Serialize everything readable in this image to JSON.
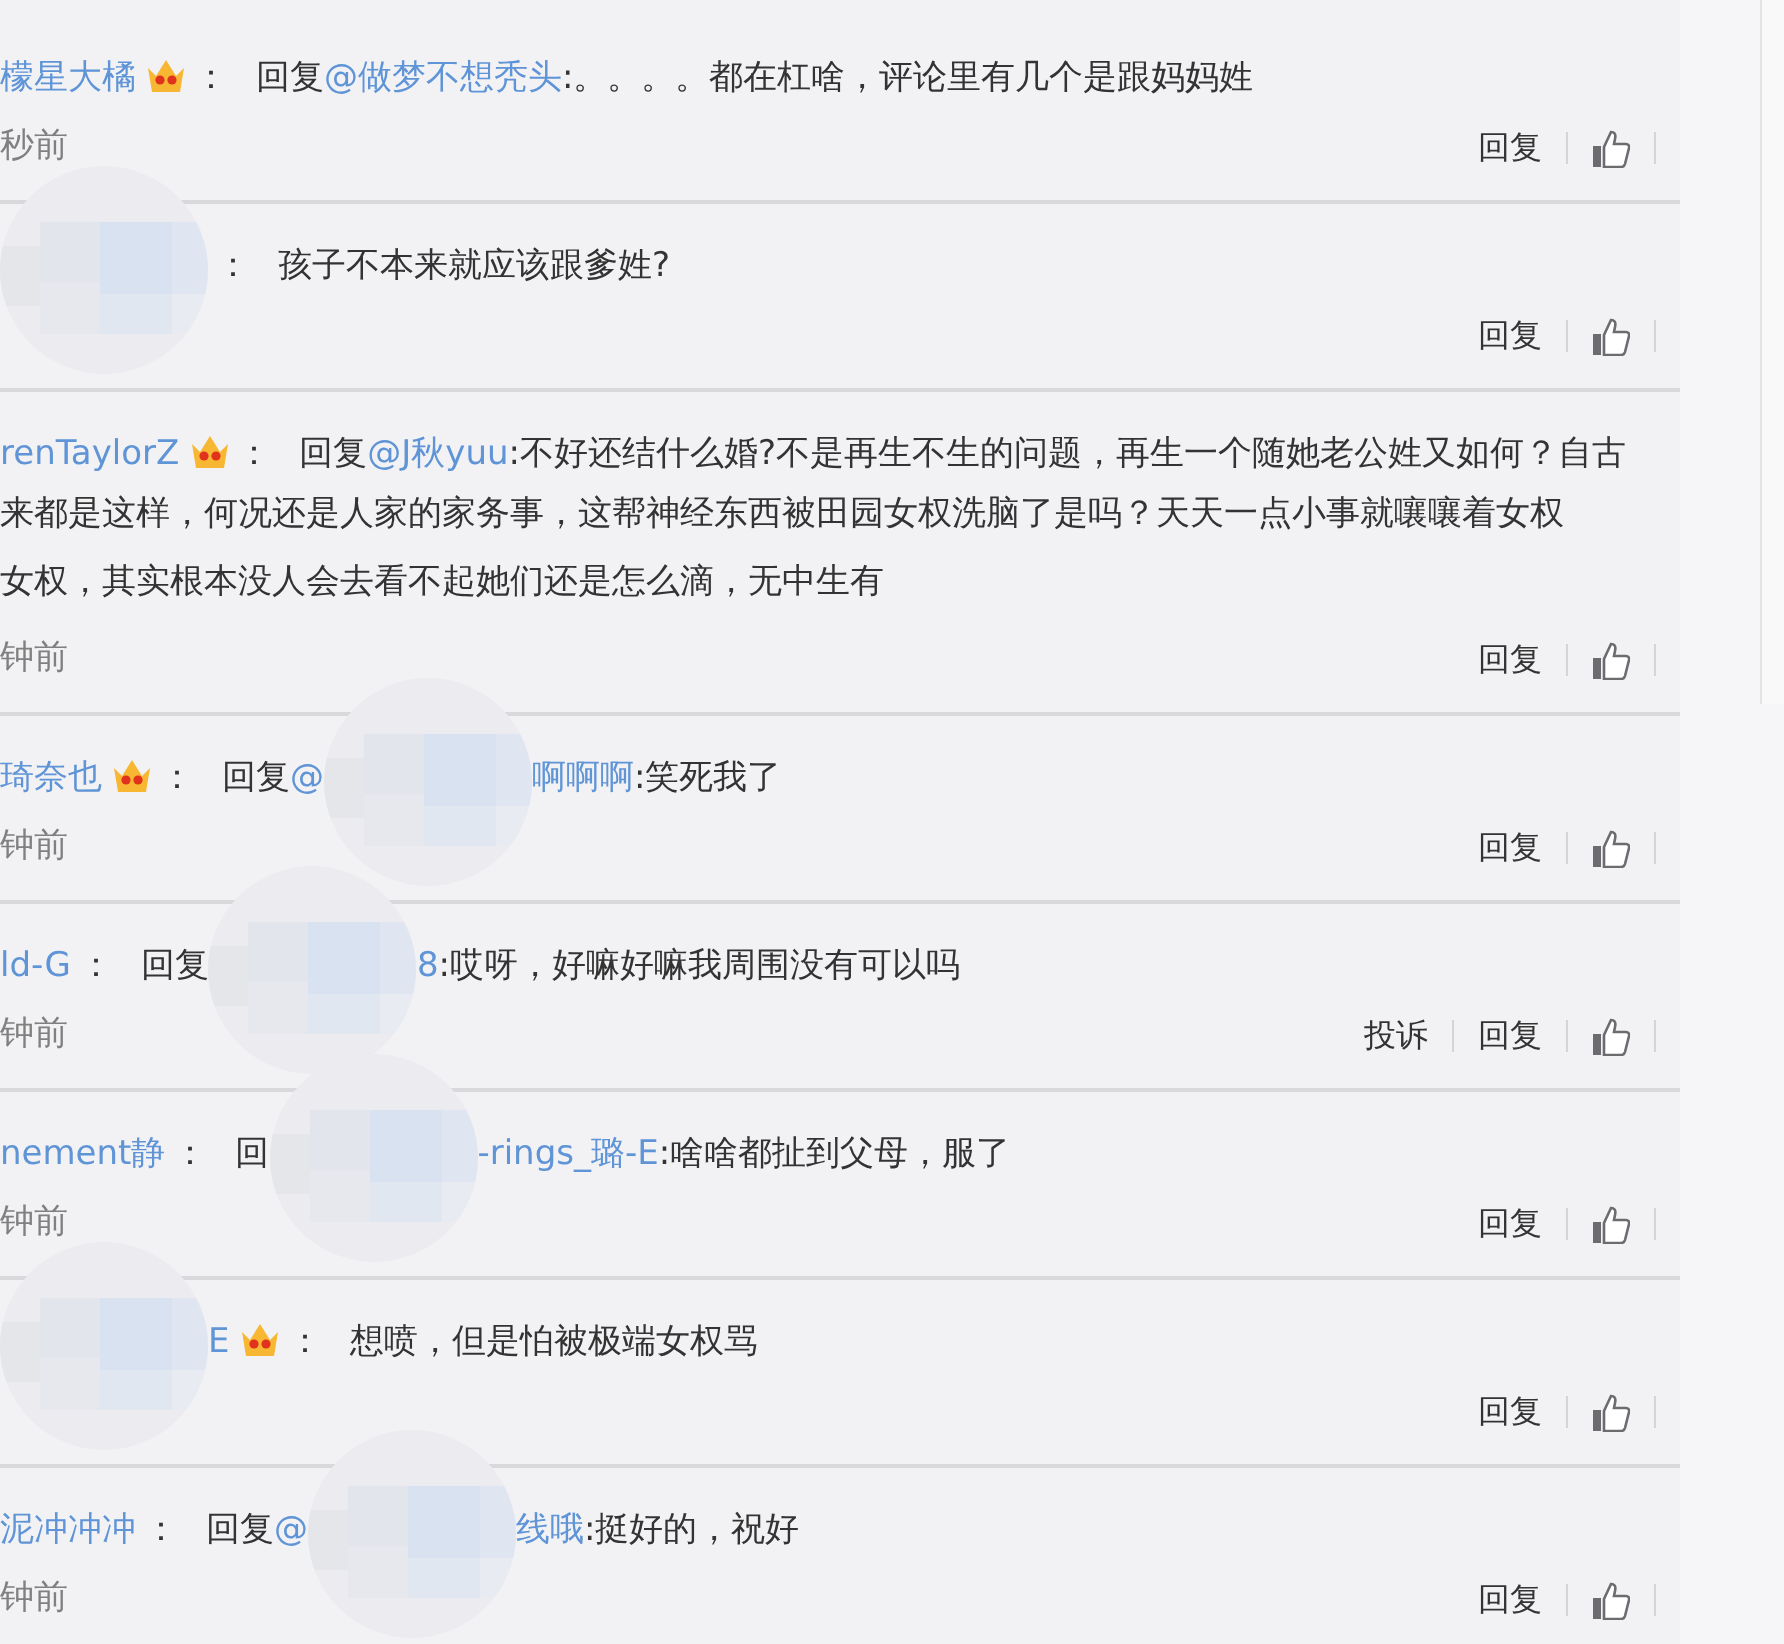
{
  "comments": [
    {
      "author": [
        {
          "kind": "link",
          "text": "檬星大橘"
        }
      ],
      "vip": true,
      "separator": "：",
      "body": [
        {
          "kind": "text",
          "text": "回复"
        },
        {
          "kind": "link",
          "text": "@做梦不想秃头"
        },
        {
          "kind": "text",
          "text": ":。。。。都在杠啥，评论里有几个是跟妈妈姓"
        }
      ],
      "time": "秒前",
      "actions": [
        "回复"
      ]
    },
    {
      "author": [
        {
          "kind": "redacted"
        }
      ],
      "vip": false,
      "separator": "：",
      "body": [
        {
          "kind": "text",
          "text": "孩子不本来就应该跟爹姓?"
        }
      ],
      "actions": [
        "回复"
      ]
    },
    {
      "author": [
        {
          "kind": "link",
          "text": "renTaylorZ"
        }
      ],
      "vip": true,
      "separator": "：",
      "body": [
        {
          "kind": "text",
          "text": "回复"
        },
        {
          "kind": "link",
          "text": "@J秋yuu"
        },
        {
          "kind": "text",
          "text": ":不好还结什么婚?不是再生不生的问题，再生一个随她老公姓又如何？自古"
        }
      ],
      "more_lines": [
        "来都是这样，何况还是人家的家务事，这帮神经东西被田园女权洗脑了是吗？天天一点小事就嚷嚷着女权",
        "女权，其实根本没人会去看不起她们还是怎么滴，无中生有"
      ],
      "time": "钟前",
      "actions": [
        "回复"
      ]
    },
    {
      "author": [
        {
          "kind": "link",
          "text": "琦奈也"
        }
      ],
      "vip": true,
      "separator": "：",
      "body": [
        {
          "kind": "text",
          "text": "回复"
        },
        {
          "kind": "link",
          "text": "@"
        },
        {
          "kind": "redacted"
        },
        {
          "kind": "link",
          "text": "啊啊啊"
        },
        {
          "kind": "text",
          "text": ":笑死我了"
        }
      ],
      "time": "钟前",
      "actions": [
        "回复"
      ]
    },
    {
      "author": [
        {
          "kind": "link",
          "text": "ld-G"
        }
      ],
      "vip": false,
      "separator": "：",
      "body": [
        {
          "kind": "text",
          "text": "回复"
        },
        {
          "kind": "redacted"
        },
        {
          "kind": "link",
          "text": "8"
        },
        {
          "kind": "text",
          "text": ":哎呀，好嘛好嘛我周围没有可以吗"
        }
      ],
      "time": "钟前",
      "actions": [
        "投诉",
        "回复"
      ]
    },
    {
      "author": [
        {
          "kind": "link",
          "text": "nement静"
        }
      ],
      "vip": false,
      "separator": "：",
      "body": [
        {
          "kind": "text",
          "text": "回"
        },
        {
          "kind": "redacted"
        },
        {
          "kind": "link",
          "text": "-rings_璐-E"
        },
        {
          "kind": "text",
          "text": ":啥啥都扯到父母，服了"
        }
      ],
      "time": "钟前",
      "actions": [
        "回复"
      ]
    },
    {
      "author": [
        {
          "kind": "redacted"
        },
        {
          "kind": "link",
          "text": "E"
        }
      ],
      "vip": true,
      "separator": "：",
      "body": [
        {
          "kind": "text",
          "text": "想喷，但是怕被极端女权骂"
        }
      ],
      "actions": [
        "回复"
      ]
    },
    {
      "author": [
        {
          "kind": "link",
          "text": "泥冲冲冲"
        }
      ],
      "vip": false,
      "separator": "：",
      "body": [
        {
          "kind": "text",
          "text": "回复"
        },
        {
          "kind": "link",
          "text": "@"
        },
        {
          "kind": "redacted"
        },
        {
          "kind": "link",
          "text": "线哦"
        },
        {
          "kind": "text",
          "text": ":挺好的，祝好"
        }
      ],
      "time": "钟前",
      "actions": [
        "回复"
      ]
    }
  ]
}
